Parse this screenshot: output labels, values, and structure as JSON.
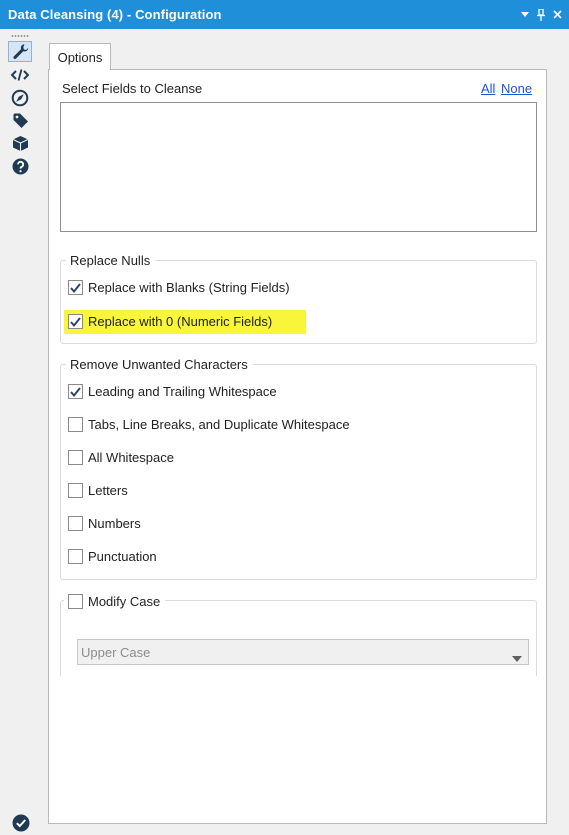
{
  "window": {
    "title": "Data Cleansing (4) - Configuration",
    "controls": [
      "dropdown-icon",
      "pin-icon",
      "close-icon"
    ]
  },
  "rail": {
    "icons": [
      "wrench-icon",
      "code-icon",
      "compass-icon",
      "tag-icon",
      "box-icon",
      "help-icon"
    ],
    "active": "wrench-icon",
    "status_icon": "check-circle-icon"
  },
  "tabs": [
    {
      "label": "Options",
      "active": true
    }
  ],
  "fields": {
    "heading": "Select Fields to Cleanse",
    "all_link": "All",
    "none_link": "None",
    "items": []
  },
  "replace_nulls": {
    "legend": "Replace Nulls",
    "options": [
      {
        "label": "Replace with Blanks (String Fields)",
        "checked": true
      },
      {
        "label": "Replace with 0 (Numeric Fields)",
        "checked": true,
        "highlighted": true
      }
    ]
  },
  "remove_chars": {
    "legend": "Remove Unwanted Characters",
    "options": [
      {
        "label": "Leading and Trailing Whitespace",
        "checked": true
      },
      {
        "label": "Tabs, Line Breaks, and Duplicate Whitespace",
        "checked": false
      },
      {
        "label": "All Whitespace",
        "checked": false
      },
      {
        "label": "Letters",
        "checked": false
      },
      {
        "label": "Numbers",
        "checked": false
      },
      {
        "label": "Punctuation",
        "checked": false
      }
    ]
  },
  "modify_case": {
    "label": "Modify Case",
    "checked": false,
    "selected": "Upper Case",
    "enabled": false
  },
  "colors": {
    "titlebar": "#1e8fd8",
    "highlight": "#f8f53a",
    "link": "#1a56c8"
  }
}
